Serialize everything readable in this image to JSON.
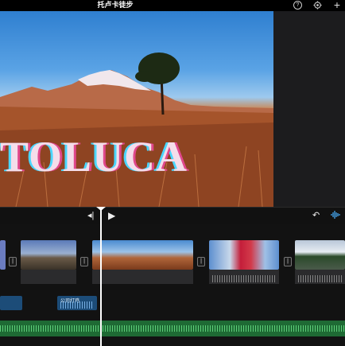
{
  "app": {
    "title": "托卢卡徒步",
    "help_icon": "question-circle-icon",
    "settings_icon": "gear-icon",
    "add_icon": "plus-icon"
  },
  "preview": {
    "overlay_text": "TOLUCA"
  },
  "controls": {
    "skip_back_icon": "skip-to-start-icon",
    "play_icon": "play-icon",
    "undo_icon": "undo-icon",
    "audio_waveform_icon": "audio-waveform-icon"
  },
  "timeline": {
    "audio_clip_label": "公司打鸡"
  },
  "colors": {
    "audio_clip": "#1c4c78",
    "music_track": "#1e6a34",
    "accent": "#4ab0ff"
  }
}
